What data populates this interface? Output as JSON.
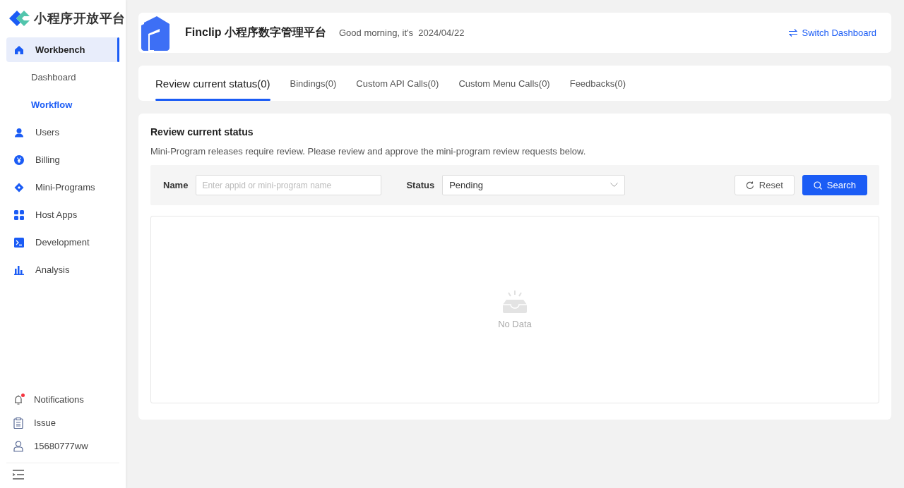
{
  "sidebar": {
    "logo_text": "小程序开放平台",
    "nav": [
      {
        "label": "Workbench",
        "selected": true,
        "children": [
          {
            "label": "Dashboard",
            "selected": false
          },
          {
            "label": "Workflow",
            "selected": true
          }
        ]
      },
      {
        "label": "Users",
        "selected": false
      },
      {
        "label": "Billing",
        "selected": false
      },
      {
        "label": "Mini-Programs",
        "selected": false
      },
      {
        "label": "Host Apps",
        "selected": false
      },
      {
        "label": "Development",
        "selected": false
      },
      {
        "label": "Analysis",
        "selected": false
      }
    ],
    "bottom": [
      {
        "label": "Notifications",
        "unread": true
      },
      {
        "label": "Issue",
        "unread": false
      },
      {
        "label": "15680777ww",
        "unread": false
      }
    ]
  },
  "header": {
    "title": "Finclip 小程序数字管理平台",
    "greeting": "Good morning, it's",
    "date": "2024/04/22",
    "switch_link": "Switch Dashboard"
  },
  "tabs": [
    {
      "label": "Review current status(0)",
      "selected": true
    },
    {
      "label": "Bindings(0)",
      "selected": false
    },
    {
      "label": "Custom API Calls(0)",
      "selected": false
    },
    {
      "label": "Custom Menu Calls(0)",
      "selected": false
    },
    {
      "label": "Feedbacks(0)",
      "selected": false
    }
  ],
  "panel": {
    "title": "Review current status",
    "description": "Mini-Program releases require review. Please review and approve the mini-program review requests below.",
    "filters": {
      "name_label": "Name",
      "name_placeholder": "Enter appid or mini-program name",
      "status_label": "Status",
      "status_value": "Pending",
      "reset_button": "Reset",
      "search_button": "Search"
    },
    "empty_text": "No Data"
  }
}
